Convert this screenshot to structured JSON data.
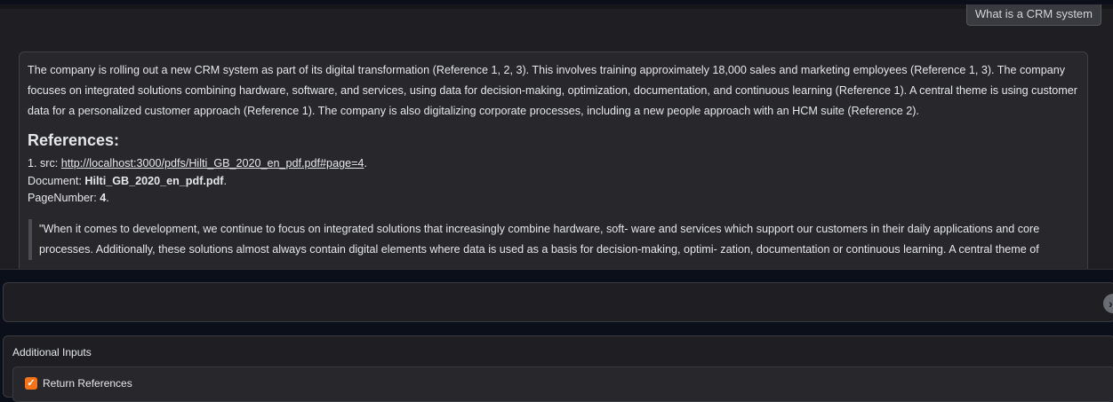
{
  "chat": {
    "user_message": "What is a CRM system",
    "answer": "The company is rolling out a new CRM system as part of its digital transformation (Reference 1, 2, 3). This involves training approximately 18,000 sales and marketing employees (Reference 1, 3). The company focuses on integrated solutions combining hardware, software, and services, using data for decision-making, optimization, documentation, and continuous learning (Reference 1). A central theme is using customer data for a personalized customer approach (Reference 1). The company is also digitalizing corporate processes, including a new people approach with an HCM suite (Reference 2).",
    "references_heading": "References:",
    "references": [
      {
        "number_src_prefix": "1. src: ",
        "url": "http://localhost:3000/pdfs/Hilti_GB_2020_en_pdf.pdf#page=4",
        "url_suffix": ".",
        "document_prefix": "Document: ",
        "document": "Hilti_GB_2020_en_pdf.pdf",
        "document_suffix": ".",
        "page_prefix": "PageNumber: ",
        "page": "4",
        "page_suffix": ".",
        "quote": "\"When it comes to development, we continue to focus on integrated solutions that increasingly combine hardware, soft- ware and services which support our customers in their daily applications and core processes. Additionally, these solutions almost always contain digital elements where data is used as a basis for decision-making, optimi- zation, documentation or continuous learning. A central theme of"
      }
    ]
  },
  "input": {
    "value": "",
    "placeholder": ""
  },
  "additional_inputs": {
    "title": "Additional Inputs",
    "return_references_label": "Return References",
    "return_references_checked": true
  },
  "colors": {
    "accent": "#f97316",
    "panel": "#1f1f23",
    "message_bg": "#27272c"
  },
  "icons": {
    "checkbox": "check-icon",
    "submit": "send-icon"
  }
}
